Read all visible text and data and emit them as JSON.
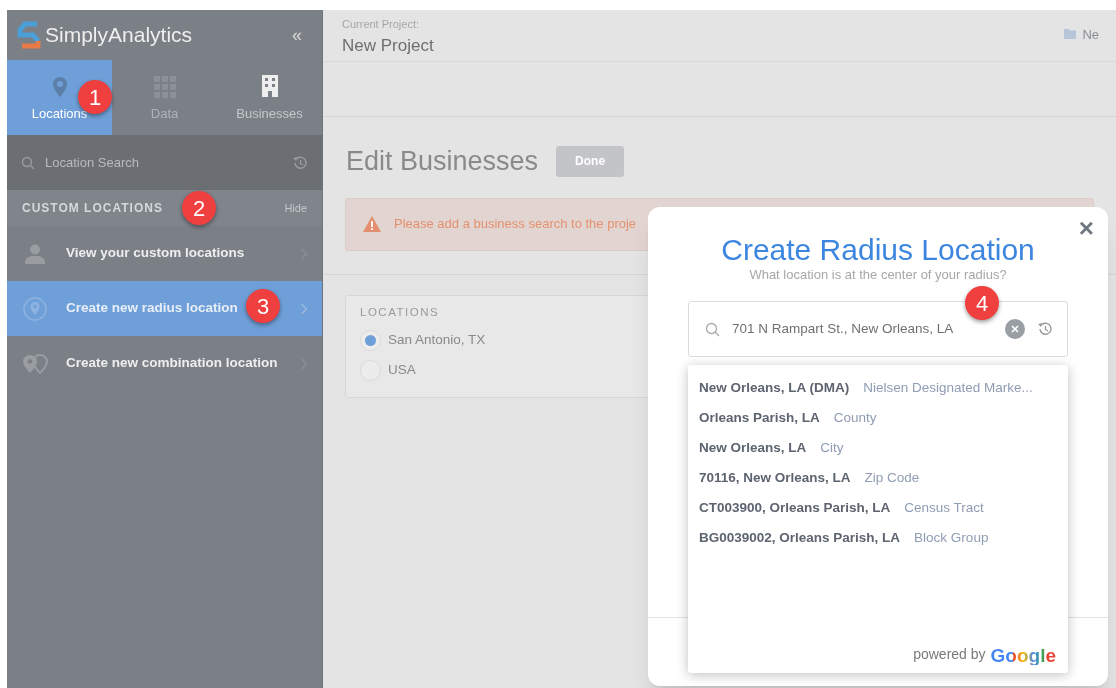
{
  "sidebar": {
    "logo": "SimplyAnalytics",
    "collapse": "«",
    "tabs": [
      {
        "label": "Locations",
        "selected": true
      },
      {
        "label": "Data",
        "selected": false
      },
      {
        "label": "Businesses",
        "selected": false
      }
    ],
    "search": {
      "placeholder": "Location Search"
    },
    "section": {
      "title": "CUSTOM LOCATIONS",
      "action": "Hide"
    },
    "items": [
      {
        "label": "View your custom locations",
        "selected": false,
        "kind": "person"
      },
      {
        "label": "Create new radius location",
        "selected": true,
        "kind": "radius"
      },
      {
        "label": "Create new combination location",
        "selected": false,
        "kind": "combination"
      }
    ]
  },
  "header": {
    "caption": "Current Project:",
    "project": "New Project",
    "right": "Ne"
  },
  "page": {
    "title": "Edit Businesses",
    "done": "Done",
    "alert": "Please add a business search to the proje",
    "locations": {
      "title": "LOCATIONS",
      "options": [
        {
          "label": "San Antonio, TX",
          "selected": true
        },
        {
          "label": "USA",
          "selected": false
        }
      ]
    }
  },
  "dialog": {
    "close": "×",
    "title": "Create Radius Location",
    "subtitle": "What location is at the center of your radius?",
    "field": {
      "value": "701 N Rampart St., New Orleans, LA"
    },
    "suggestions": [
      {
        "name": "New Orleans, LA (DMA)",
        "type": "Nielsen Designated Marke..."
      },
      {
        "name": "Orleans Parish, LA",
        "type": "County"
      },
      {
        "name": "New Orleans, LA",
        "type": "City"
      },
      {
        "name": "70116, New Orleans, LA",
        "type": "Zip Code"
      },
      {
        "name": "CT003900, Orleans Parish, LA",
        "type": "Census Tract"
      },
      {
        "name": "BG0039002, Orleans Parish, LA",
        "type": "Block Group"
      }
    ],
    "powered": "powered by",
    "brand": "Google"
  },
  "callouts": [
    {
      "label": "1"
    },
    {
      "label": "2"
    },
    {
      "label": "3"
    },
    {
      "label": "4"
    }
  ]
}
